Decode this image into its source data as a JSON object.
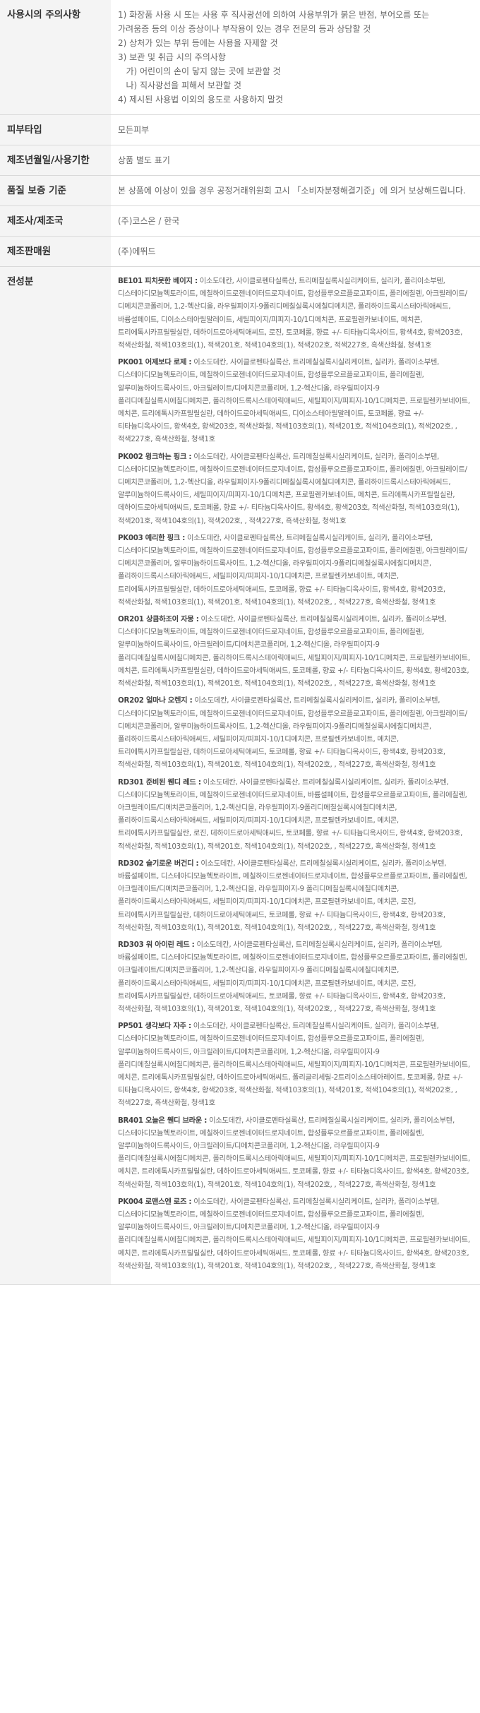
{
  "table": {
    "rows": [
      {
        "label": "사용시의 주의사항",
        "lines": [
          "1) 화장품 사용 시 또는 사용 후 직사광선에 의하여 사용부위가 붉은 반점, 부어오름 또는",
          "가려움증 등의 이상 증상이나 부작용이 있는 경우 전문의 등과 상담할 것",
          "2) 상처가 있는 부위 등에는 사용을 자제할 것",
          "3) 보관 및 취급 시의 주의사항",
          "   가) 어린이의 손이 닿지 않는 곳에 보관할 것",
          "   나) 직사광선을 피해서 보관할 것",
          "4) 제시된 사용법 이외의 용도로 사용하지 말것"
        ]
      },
      {
        "label": "피부타입",
        "value": "모든피부"
      },
      {
        "label": "제조년월일/사용기한",
        "value": "상품 별도 표기"
      },
      {
        "label": "품질 보증 기준",
        "value": "본 상품에 이상이 있을 경우 공정거래위원회 고시 「소비자분쟁해결기준」에 의거 보상해드립니다."
      },
      {
        "label": "제조사/제조국",
        "value": "(주)코스온 / 한국"
      },
      {
        "label": "제조판매원",
        "value": "(주)에뛰드"
      },
      {
        "label": "전성분",
        "ingredients": [
          {
            "name": "BE101 피치못한 베이지 :",
            "text": "이소도데칸, 사이클로펜타실록산, 트리메칠실록시실리케이트, 실리카, 폴리이소부텐, 디스테아디모늄헥토라이트, 메칠하이드로젠네이터드로지네이트, 합성플루오르플로고파이트, 폴리에칠렌, 아크릴레이트/디메치콘코폴리머, 1,2-헥산디올, 라우릴피이지-9폴리디메칠실록시에칠디메치콘, 폴리하이드록시스테아릭애씨드, 바륨설페이트, 디이소스테아릴말레이트, 세틸피이지/피피지-10/1디메치콘, 프로필렌카보네이트, 메치콘, 트리에톡시카프릴릴실란, 데하이드로아세틱애씨드, 로진, 토코페롤, 향료 +/- 티타늄디옥사이드, 황색4호, 황색203호, 적색산화철, 적색103호의(1), 적색201호, 적색104호의(1), 적색202호, 적색227호, 흑색산화철, 청색1호"
          },
          {
            "name": "PK001 어제보다 로제 :",
            "text": "이소도데칸, 사이클로펜타실록산, 트리메칠실록시실리케이트, 실리카, 폴리이소부텐, 디스테아디모늄헥토라이트, 메칠하이드로젠네이터드로지네이트, 합성플루오르플로고파이트, 폴리에칠렌, 알루미늄하이드록사이드, 아크릴레이트/디메치콘코폴리머, 1,2-헥산디올, 라우릴피이지-9 폴리디메칠실록시에칠디메치콘, 폴리하이드록시스테아릭애씨드, 세틸피이지/피피지-10/1디메치콘, 프로필렌카보네이트, 메치콘, 트리에톡시카프릴릴실란, 데하이드로아세틱애씨드, 디이소스테아릴말레이트, 토코페롤, 향료 +/- 티타늄디옥사이드, 황색4호, 황색203호, 적색산화철, 적색103호의(1), 적색201호, 적색104호의(1), 적색202호, , 적색227호, 흑색산화철, 청색1호"
          },
          {
            "name": "PK002 윙크하는 핑크 :",
            "text": "이소도데칸, 사이클로펜타실록산, 트리메칠실록시실리케이트, 실리카, 폴리이소부텐, 디스테아디모늄헥토라이트, 메칠하이드로젠네이터드로지네이트, 합성플루오르플로고파이트, 폴리에칠렌, 아크릴레이트/디메치콘코폴리머, 1,2-헥산디올, 라우릴피이지-9폴리디메칠실록시에칠디메치콘, 폴리하이드록시스테아릭애씨드,알루미늄하이드록사이드, 세틸피이지/피피지-10/1디메치콘, 프로필렌카보네이트, 메치콘, 트리에톡시카프릴릴실란, 데하이드로아세틱애씨드, 토코페롤, 향료 +/- 티타늄디옥사이드, 황색4호, 황색203호, 적색산화철, 적색103호의(1), 적색201호, 적색104호의(1), 적색202호, , 적색227호, 흑색산화철, 청색1호"
          },
          {
            "name": "PK003 예리한 핑크 :",
            "text": "이소도데칸, 사이클로펜타실록산, 트리메칠실록시실리케이트, 실리카, 폴리이소부텐, 디스테아디모늄헥토라이트, 메칠하이드로젠네이터드로지네이트, 합성플루오르플로고파이트, 폴리에칠렌, 아크릴레이트/디메치콘코폴리머, 알루미늄하이드록사이드, 1,2-헥산디올, 라우릴피이지-9폴리디메칠실록시에칠디메치콘, 폴리하이드록시스테아릭애씨드, 세틸피이지/피피지-10/1디메치콘, 프로필렌카보네이트, 메치콘, 트리에톡시카프릴릴실란, 데하이드로아세틱애씨드, 토코페롤, 향료 +/- 티타늄디옥사이드, 황색4호, 황색203호, 적색산화철, 적색103호의(1), 적색201호, 적색104호의(1), 적색202호, , 적색227호, 흑색산화철, 청색1호"
          },
          {
            "name": "OR201 상큼하조이 자몽 :",
            "text": "이소도데칸, 사이클로펜타실록산, 트리메칠실록시실리케이트, 실리카, 폴리이소부텐, 디스테아디모늄헥토라이트, 메칠하이드로젠네이터드로지네이트, 합성플루오르플로고파이트, 폴리에칠렌, 알루미늄하이드록사이드, 아크릴레이트/디메치콘코폴리머, 1,2-헥산디올, 라우릴피이지-9 폴리디메칠실록시에칠디메치콘, 폴리하이드록시스테아릭애씨드, 세틸피이지/피피지-10/1디메치콘, 프로필렌카보네이트, 메치콘, 트리에톡시카프릴릴실란, 데하이드로아세틱애씨드, 토코페롤, 향료 +/- 티타늄디옥사이드, 황색4호, 황색203호, 적색산화철, 적색103호의(1), 적색201호, 적색104호의(1), 적색202호, , 적색227호, 흑색산화철, 청색1호"
          },
          {
            "name": "OR202 얼마나 오렌지 :",
            "text": "이소도데칸, 사이클로펜타실록산, 트리메칠실록시실리케이트, 실리카, 폴리이소부텐, 디스테아디모늄헥토라이트, 메칠하이드로젠네이터드로지네이트, 합성플루오르플로고파이트, 폴리에칠렌, 아크릴레이트/디메치콘코폴리머, 알루미늄하이드록사이드, 1,2-헥산디올, 라우릴피이지-9폴리디메칠실록시에칠디메치콘, 폴리하이드록시스테아릭애씨드, 세틸피이지/피피지-10/1디메치콘, 프로필렌카보네이트, 메치콘, 트리에톡시카프릴릴실란, 데하이드로아세틱애씨드, 토코페롤, 향료 +/- 티타늄디옥사이드, 황색4호, 황색203호, 적색산화철, 적색103호의(1), 적색201호, 적색104호의(1), 적색202호, , 적색227호, 흑색산화철, 청색1호"
          },
          {
            "name": "RD301 준비된 웬디 레드 :",
            "text": "이소도데칸, 사이클로펜타실록산, 트리메칠실록시실리케이트, 실리카, 폴리이소부텐, 디스테아디모늄헥토라이트, 메칠하이드로젠네이터드로지네이트, 바륨설페이트, 합성플루오르플로고파이트, 폴리에칠렌, 아크릴레이트/디메치콘코폴리머, 1,2-헥산디올, 라우릴피이지-9폴리디메칠실록시에칠디메치콘, 폴리하이드록시스테아릭애씨드, 세틸피이지/피피지-10/1디메치콘, 프로필렌카보네이트, 메치콘, 트리에톡시카프릴릴실란, 로진, 데하이드로아세틱애씨드, 토코페롤, 향료 +/- 티타늄디옥사이드, 황색4호, 황색203호, 적색산화철, 적색103호의(1), 적색201호, 적색104호의(1), 적색202호, , 적색227호, 흑색산화철, 청색1호"
          },
          {
            "name": "RD302 슬기로운 버건디 :",
            "text": "이소도데칸, 사이클로펜타실록산, 트리메칠실록시실리케이트, 실리카, 폴리이소부텐, 바륨설페이트, 디스테아디모늄헥토라이트, 메칠하이드로젠네이터드로지네이트, 합성플루오르플로고파이트, 폴리에칠렌, 아크릴레이트/디메치콘코폴리머, 1,2-헥산디올, 라우릴피이지-9 폴리디메칠실록시에칠디메치콘, 폴리하이드록시스테아릭애씨드, 세틸피이지/피피지-10/1디메치콘, 프로필렌카보네이트, 메치콘, 로진, 트리에톡시카프릴릴실란, 데하이드로아세틱애씨드, 토코페롤, 향료 +/- 티타늄디옥사이드, 황색4호, 황색203호, 적색산화철, 적색103호의(1), 적색201호, 적색104호의(1), 적색202호, , 적색227호, 흑색산화철, 청색1호"
          },
          {
            "name": "RD303 워 아이린 레드 :",
            "text": "이소도데칸, 사이클로펜타실록산, 트리메칠실록시실리케이트, 실리카, 폴리이소부텐, 바륨설페이트, 디스테아디모늄헥토라이트, 메칠하이드로젠네이터드로지네이트, 합성플루오르플로고파이트, 폴리에칠렌, 아크릴레이트/디메치콘코폴리머, 1,2-헥산디올, 라우릴피이지-9 폴리디메칠실록시에칠디메치콘, 폴리하이드록시스테아릭애씨드, 세틸피이지/피피지-10/1디메치콘, 프로필렌카보네이트, 메치콘, 로진, 트리에톡시카프릴릴실란, 데하이드로아세틱애씨드, 토코페롤, 향료 +/- 티타늄디옥사이드, 황색4호, 황색203호, 적색산화철, 적색103호의(1), 적색201호, 적색104호의(1), 적색202호, , 적색227호, 흑색산화철, 청색1호"
          },
          {
            "name": "PP501 생각보다 자주 :",
            "text": "이소도데칸, 사이클로펜타실록산, 트리메칠실록시실리케이트, 실리카, 폴리이소부텐, 디스테아디모늄헥토라이트, 메칠하이드로젠네이터드로지네이트, 합성플루오르플로고파이트, 폴리에칠렌, 알루미늄하이드록사이드, 아크릴레이트/디메치콘코폴리머, 1,2-헥산디올, 라우릴피이지-9 폴리디메칠실록시에칠디메치콘, 폴리하이드록시스테아릭애씨드, 세틸피이지/피피지-10/1디메치콘, 프로필렌카보네이트, 메치콘, 트리에톡시카프릴릴실란, 데하이드로아세틱애씨드, 폴리글리세릴-2트리이소스테아레이트, 토코페롤, 향료 +/- 티타늄디옥사이드, 황색4호, 황색203호, 적색산화철, 적색103호의(1), 적색201호, 적색104호의(1), 적색202호, , 적색227호, 흑색산화철, 청색1호"
          },
          {
            "name": "BR401 오늘은 웬디 브라운 :",
            "text": "이소도데칸, 사이클로펜타실록산, 트리메칠실록시실리케이트, 실리카, 폴리이소부텐, 디스테아디모늄헥토라이트, 메칠하이드로젠네이터드로지네이트, 합성플루오르플로고파이트, 폴리에칠렌, 알루미늄하이드록사이드, 아크릴레이트/디메치콘코폴리머, 1,2-헥산디올, 라우릴피이지-9 폴리디메칠실록시에칠디메치콘, 폴리하이드록시스테아릭애씨드, 세틸피이지/피피지-10/1디메치콘, 프로필렌카보네이트, 메치콘, 트리에톡시카프릴릴실란, 데하이드로아세틱애씨드, 토코페롤, 향료 +/- 티타늄디옥사이드, 황색4호, 황색203호, 적색산화철, 적색103호의(1), 적색201호, 적색104호의(1), 적색202호, , 적색227호, 흑색산화철, 청색1호"
          },
          {
            "name": "PK004 로맨스엔 로즈 :",
            "text": "이소도데칸, 사이클로펜타실록산, 트리메칠실록시실리케이트, 실리카, 폴리이소부텐, 디스테아디모늄헥토라이트, 메칠하이드로젠네이터드로지네이트, 합성플루오르플로고파이트, 폴리에칠렌, 알루미늄하이드록사이드, 아크릴레이트/디메치콘코폴리머, 1,2-헥산디올, 라우릴피이지-9 폴리디메칠실록시에칠디메치콘, 폴리하이드록시스테아릭애씨드, 세틸피이지/피피지-10/1디메치콘, 프로필렌카보네이트, 메치콘, 트리에톡시카프릴릴실란, 데하이드로아세틱애씨드, 토코페롤, 향료 +/- 티타늄디옥사이드, 황색4호, 황색203호, 적색산화철, 적색103호의(1), 적색201호, 적색104호의(1), 적색202호, , 적색227호, 흑색산화철, 청색1호"
          }
        ]
      }
    ]
  }
}
